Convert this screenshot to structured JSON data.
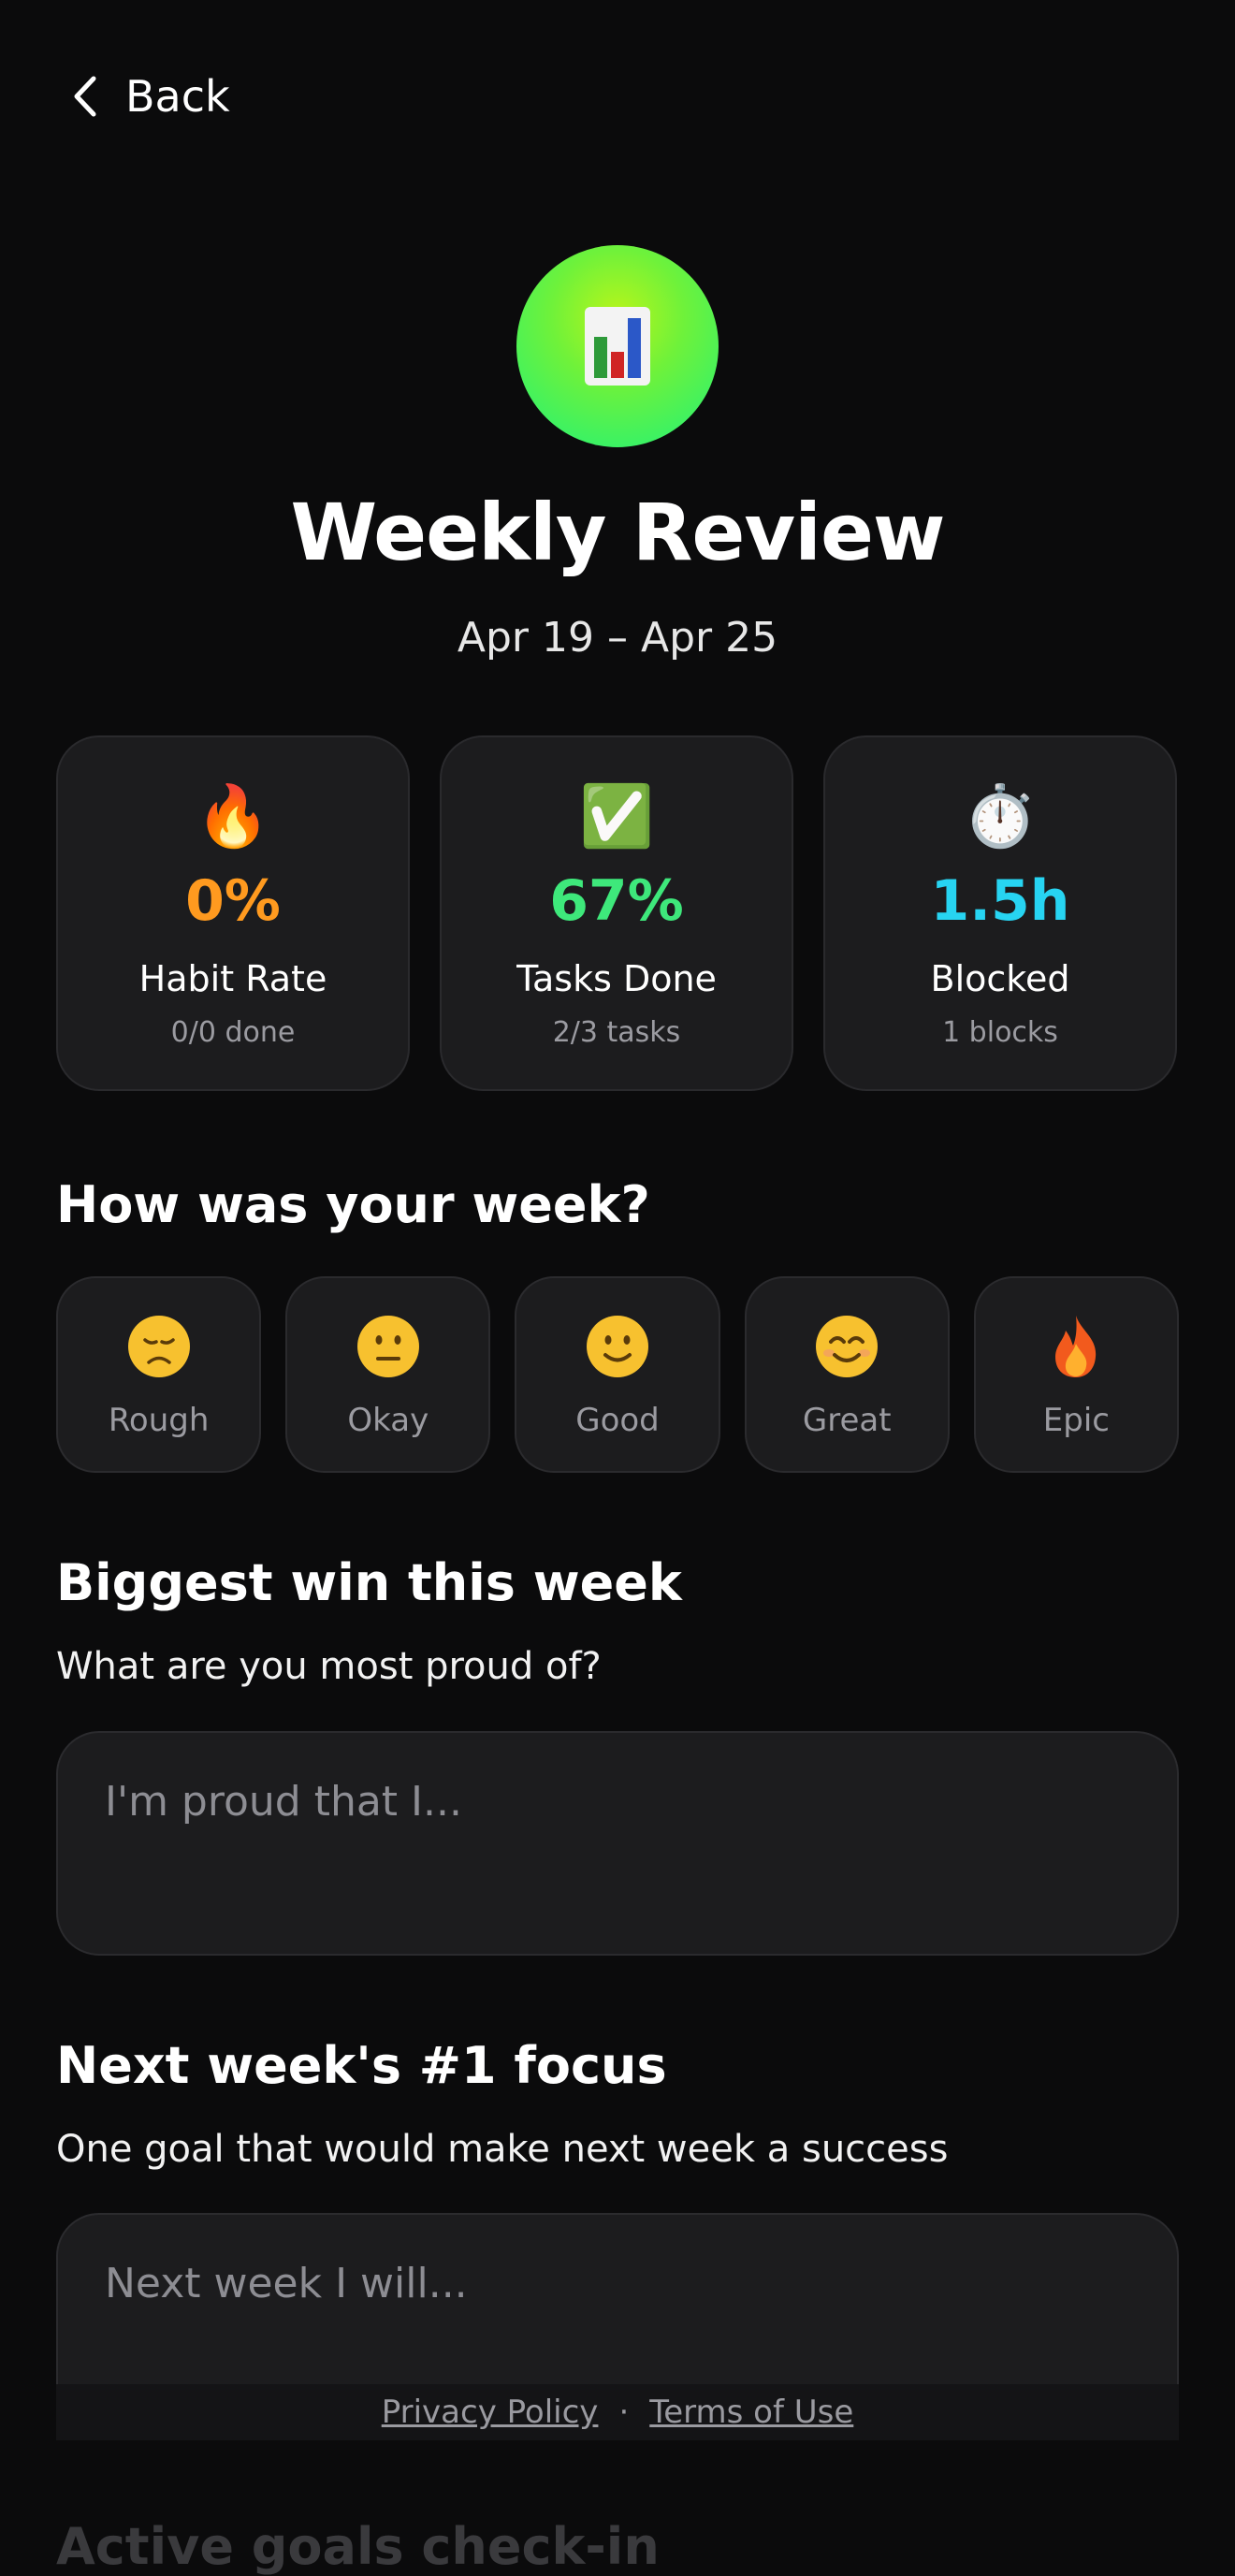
{
  "nav": {
    "back_label": "Back",
    "back_icon": "chevron-left-icon"
  },
  "header": {
    "icon": "bar-chart-icon",
    "title": "Weekly Review",
    "dates": "Apr 19 – Apr 25"
  },
  "stats": [
    {
      "icon": "fire-icon",
      "emoji": "🔥",
      "value": "0%",
      "label": "Habit Rate",
      "sub": "0/0 done",
      "color": "#ff9a1f"
    },
    {
      "icon": "check-box-icon",
      "emoji": "✅",
      "value": "67%",
      "label": "Tasks Done",
      "sub": "2/3 tasks",
      "color": "#3ee87b"
    },
    {
      "icon": "stopwatch-icon",
      "emoji": "⏱️",
      "value": "1.5h",
      "label": "Blocked",
      "sub": "1 blocks",
      "color": "#27d4f2"
    }
  ],
  "mood_section": {
    "title": "How was your week?",
    "options": [
      {
        "label": "Rough",
        "icon": "disappointed-face-icon"
      },
      {
        "label": "Okay",
        "icon": "neutral-face-icon"
      },
      {
        "label": "Good",
        "icon": "slight-smile-icon"
      },
      {
        "label": "Great",
        "icon": "smiling-face-icon"
      },
      {
        "label": "Epic",
        "icon": "fire-icon"
      }
    ]
  },
  "win_section": {
    "title": "Biggest win this week",
    "subtitle": "What are you most proud of?",
    "placeholder": "I'm proud that I..."
  },
  "focus_section": {
    "title": "Next week's #1 focus",
    "subtitle": "One goal that would make next week a success",
    "placeholder": "Next week I will..."
  },
  "footer": {
    "privacy": "Privacy Policy",
    "separator": "·",
    "terms": "Terms of Use"
  },
  "next_section": {
    "title": "Active goals check-in"
  }
}
